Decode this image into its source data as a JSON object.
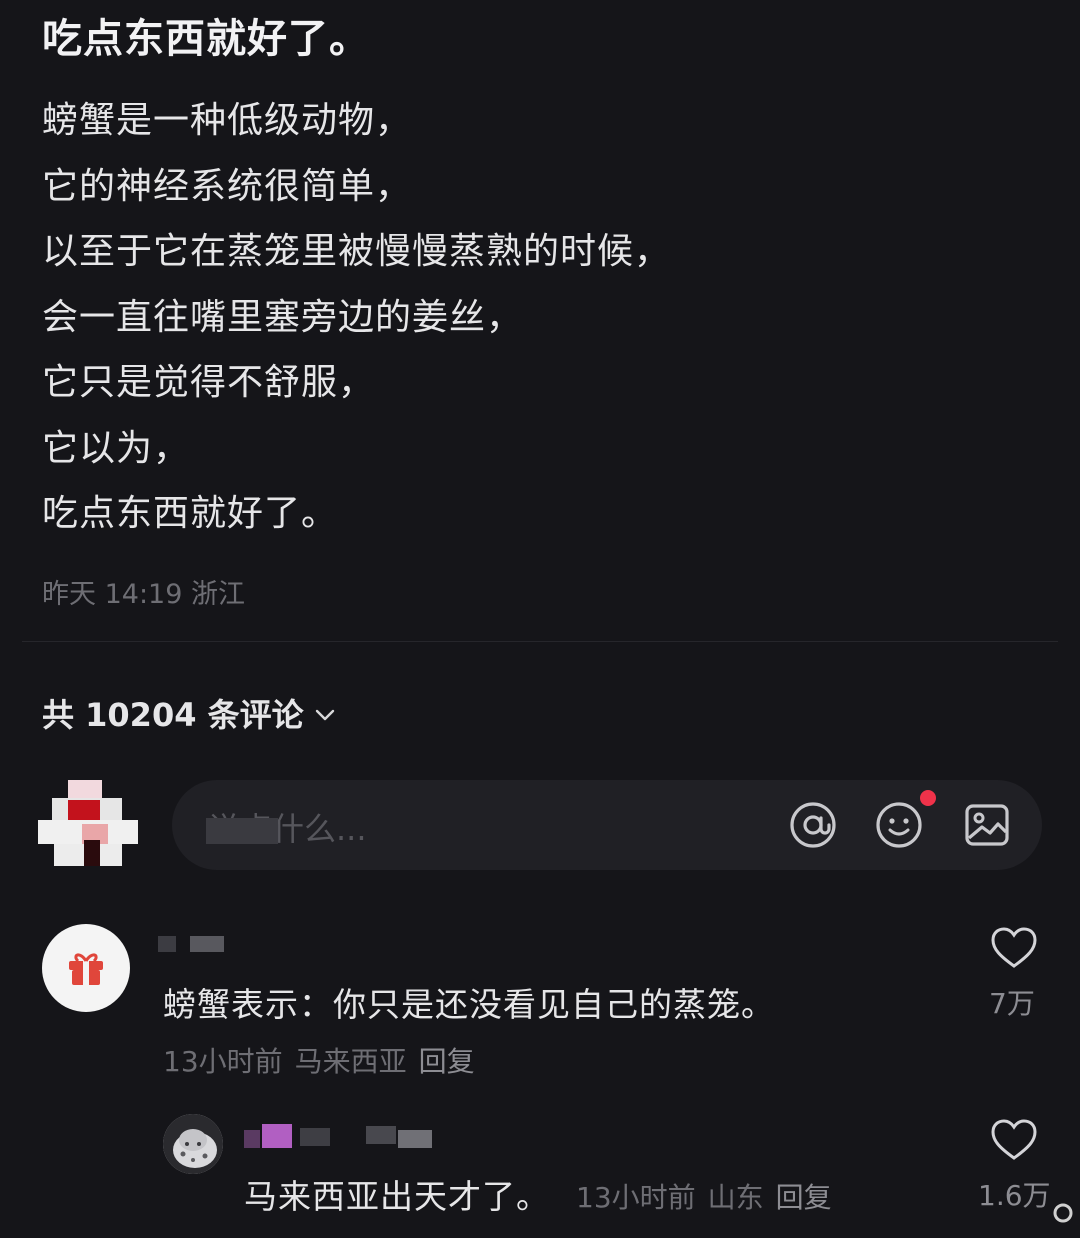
{
  "post": {
    "title": "吃点东西就好了。",
    "lines": [
      "螃蟹是一种低级动物，",
      "它的神经系统很简单，",
      "以至于它在蒸笼里被慢慢蒸熟的时候，",
      "会一直往嘴里塞旁边的姜丝，",
      "它只是觉得不舒服，",
      "它以为，",
      "吃点东西就好了。"
    ],
    "time": "昨天 14:19",
    "location": "浙江"
  },
  "comments_header": {
    "label": "共 10204 条评论",
    "icon": "chevron-down-icon"
  },
  "composer": {
    "placeholder": "说点什么...",
    "icons": [
      "at-icon",
      "emoji-icon",
      "image-icon"
    ]
  },
  "comments": [
    {
      "avatar_icon": "gift-icon",
      "text": "螃蟹表示：你只是还没看见自己的蒸笼。",
      "time": "13小时前",
      "location": "马来西亚",
      "reply_label": "回复",
      "likes": "7万"
    }
  ],
  "replies": [
    {
      "text": "马来西亚出天才了。",
      "time": "13小时前",
      "location": "山东",
      "reply_label": "回复",
      "likes": "1.6万"
    }
  ],
  "colors": {
    "background": "#151519",
    "input_background": "#202025",
    "muted_text": "#6e6e74",
    "notification_dot": "#f0324a",
    "gift_red": "#e0463b"
  }
}
